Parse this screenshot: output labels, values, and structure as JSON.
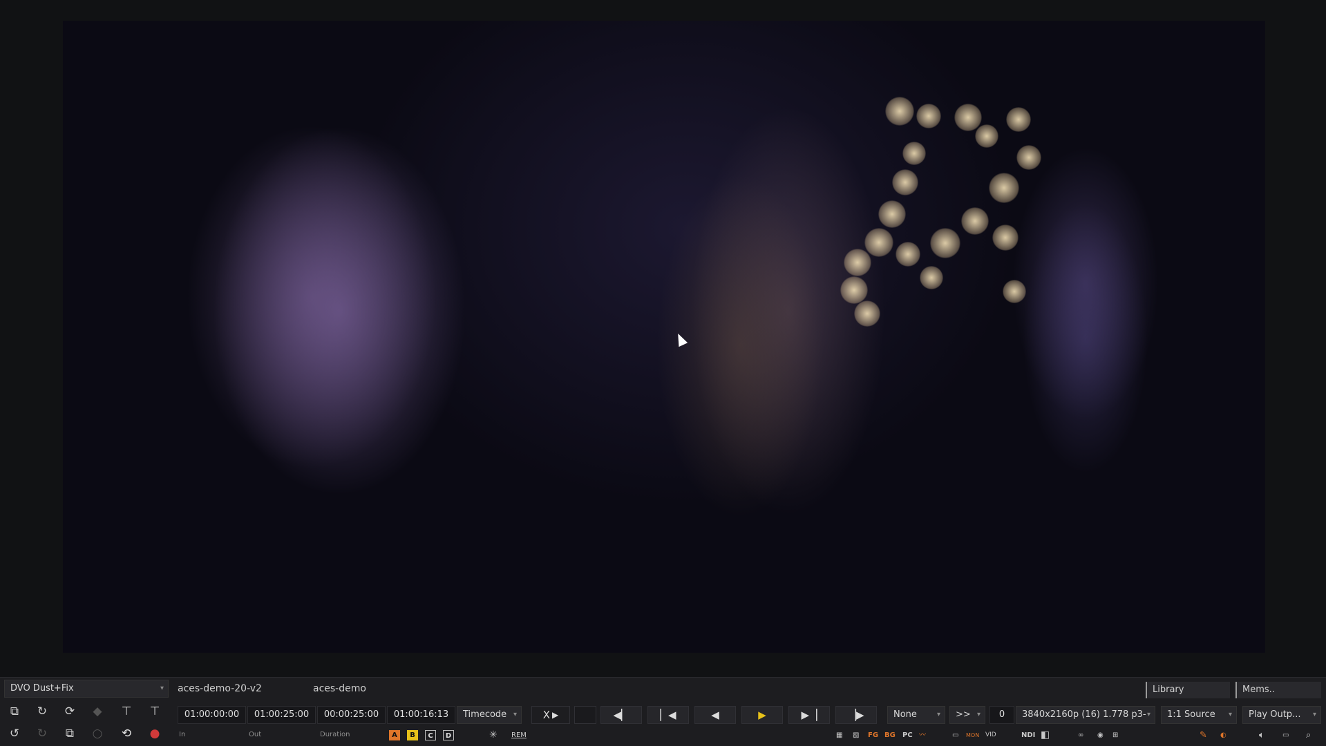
{
  "viewer": {
    "cursor_icon": "mouse-pointer-icon"
  },
  "toolbar_row1": {
    "effect_dropdown": "DVO Dust+Fix",
    "clip_name": "aces-demo-20-v2",
    "project_name": "aces-demo",
    "library_button": "Library",
    "mems_button": "Mems.."
  },
  "timecodes": {
    "in": "01:00:00:00",
    "out": "01:00:25:00",
    "duration": "00:00:25:00",
    "current": "01:00:16:13",
    "in_label": "In",
    "out_label": "Out",
    "duration_label": "Duration"
  },
  "transport": {
    "timecode_mode": "Timecode",
    "x_label": "X",
    "fx_select": "None",
    "speed_select": ">>",
    "frame_value": "0",
    "format_select": "3840x2160p (16) 1.778 p3-",
    "scale_select": "1:1 Source",
    "output_select": "Play Outp..."
  },
  "compare": {
    "a": "A",
    "b": "B",
    "c": "C",
    "d": "D",
    "rem": "REM"
  },
  "status_labels": {
    "fg": "FG",
    "bg": "BG",
    "pc": "PC",
    "mon": "MON",
    "vid": "VID",
    "ndi": "NDI"
  },
  "colors": {
    "accent_orange": "#e0762a",
    "play_yellow": "#e8c21a",
    "record_red": "#d23a3a"
  }
}
